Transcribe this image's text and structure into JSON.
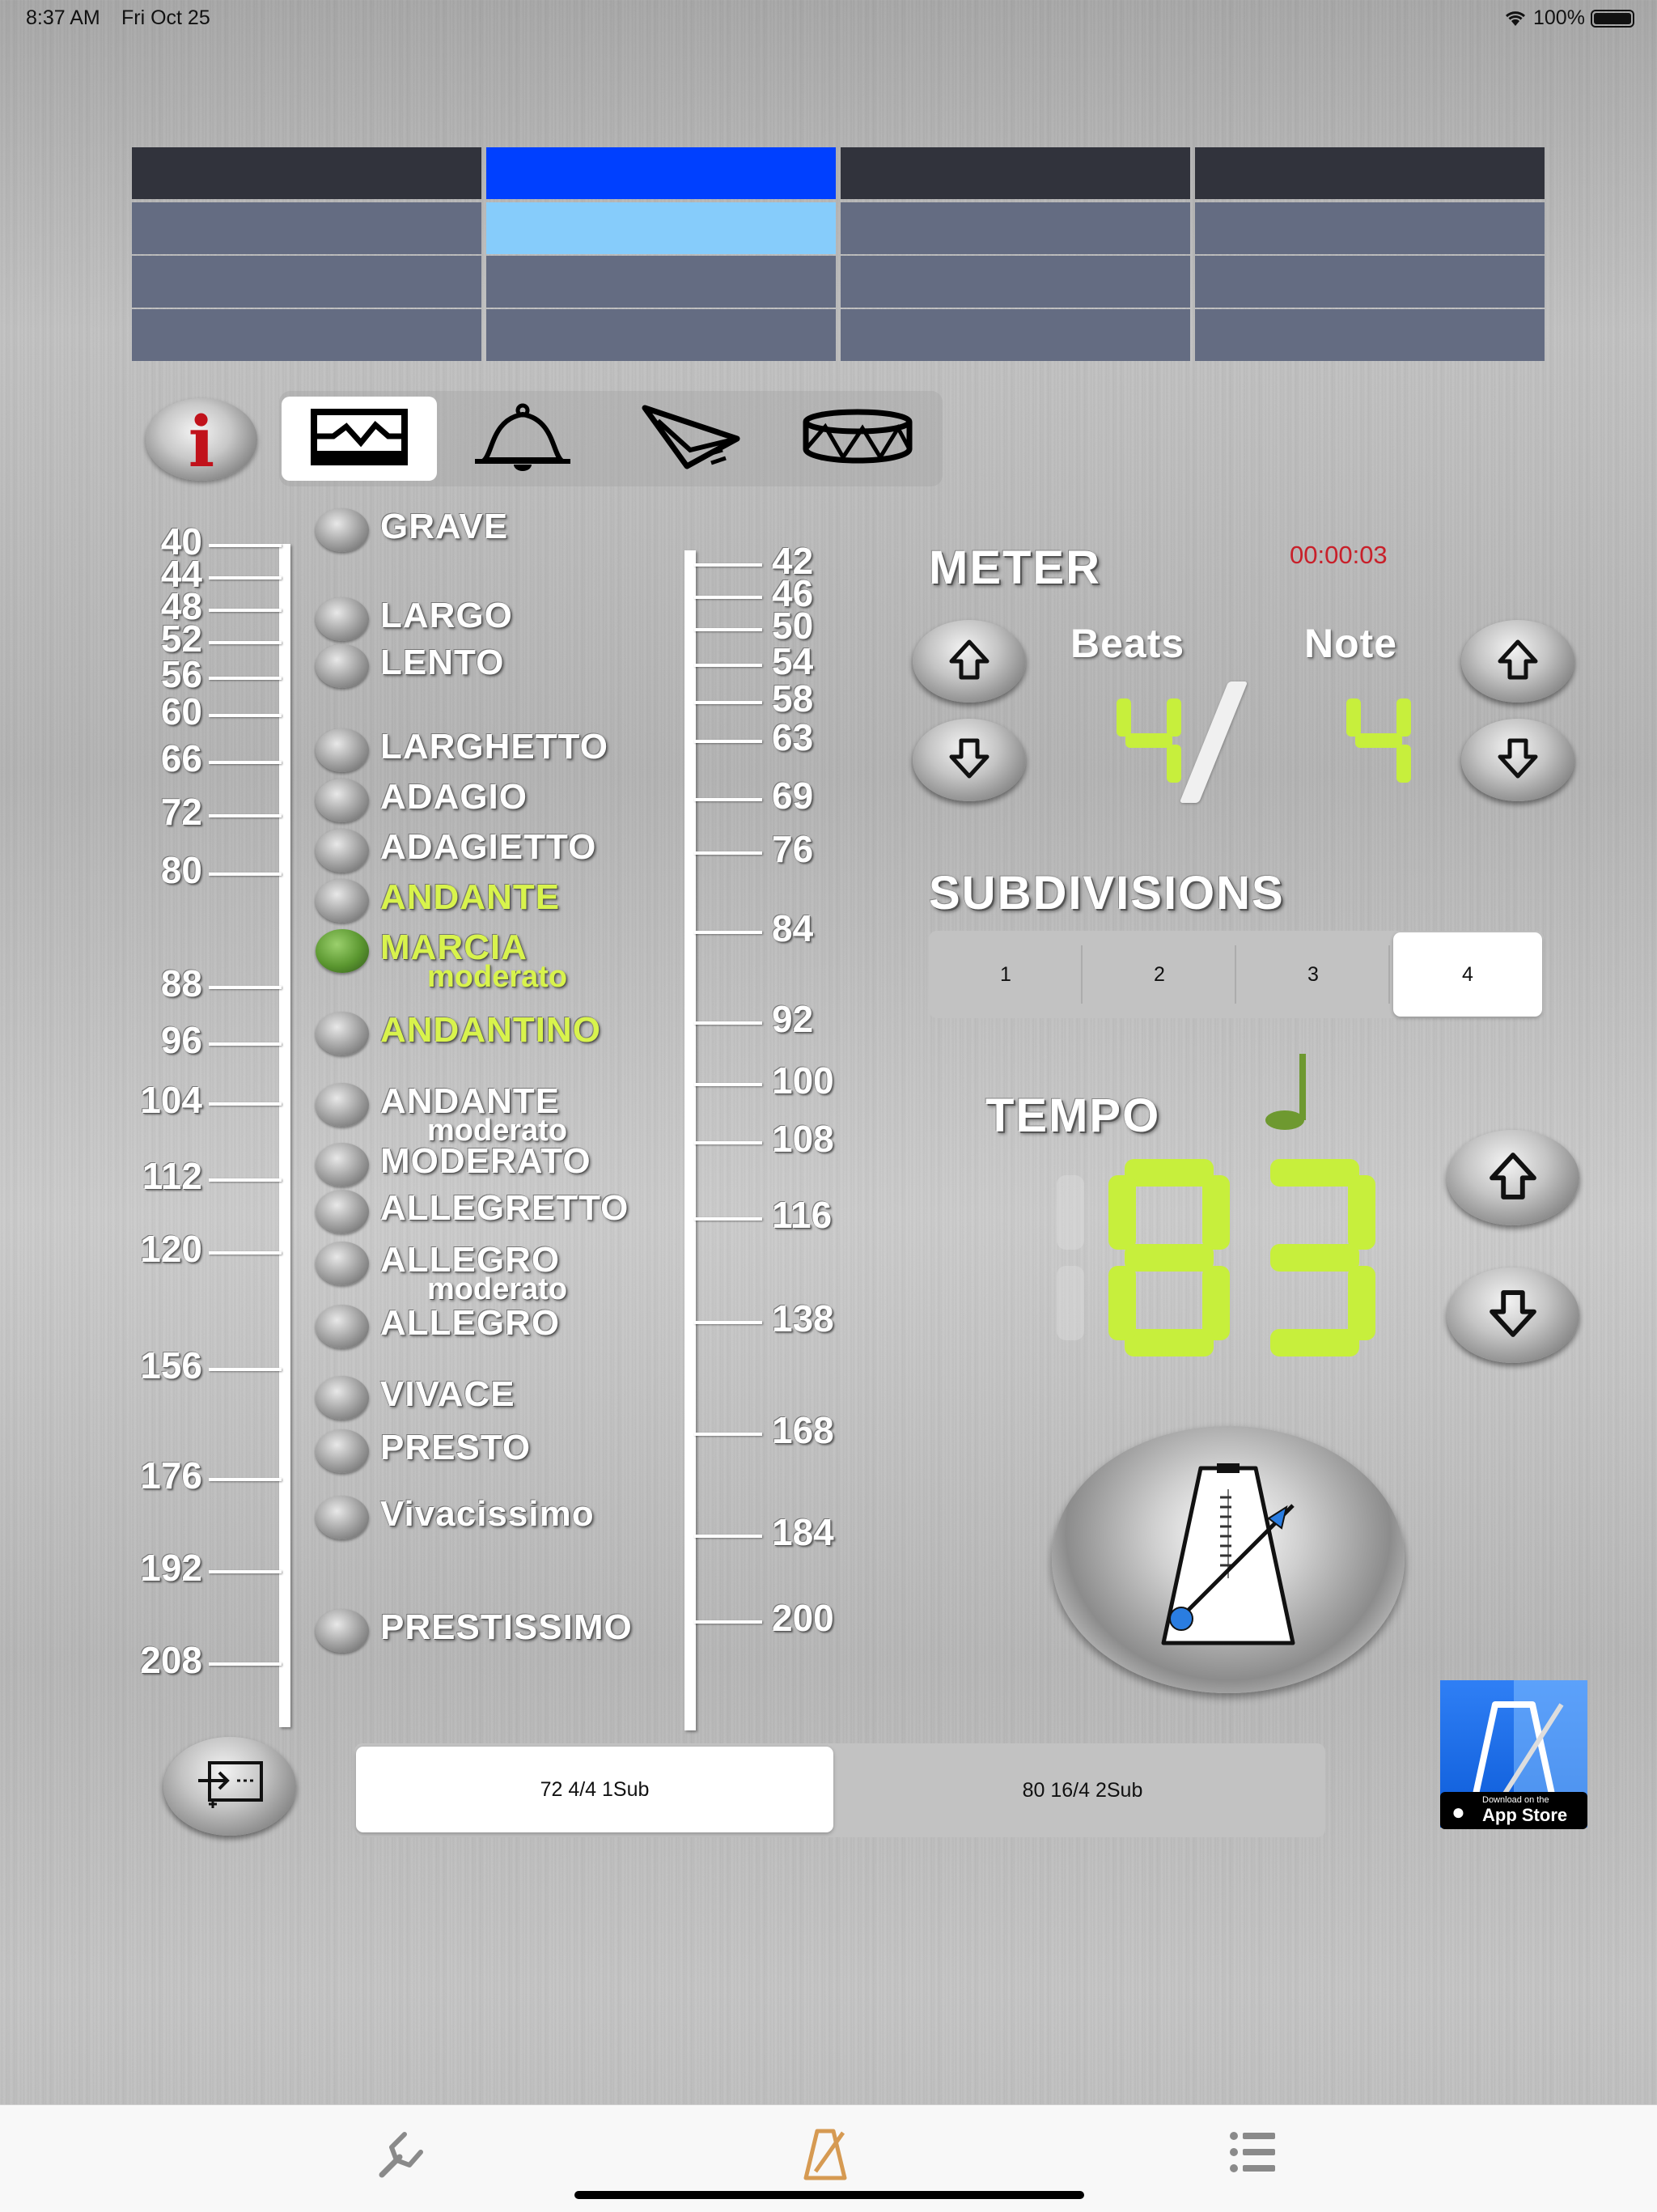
{
  "status_bar": {
    "time": "8:37 AM",
    "date": "Fri Oct 25",
    "battery": "100%"
  },
  "beat_grid": {
    "columns": 4,
    "rows": 4,
    "active_column": 2
  },
  "toolbar": {
    "info_label": "i",
    "icons": [
      "waveform-icon",
      "bell-icon",
      "paper-plane-icon",
      "drum-icon"
    ],
    "selected_index": 0
  },
  "left_scale": [
    "40",
    "44",
    "48",
    "52",
    "56",
    "60",
    "66",
    "72",
    "80",
    "88",
    "96",
    "104",
    "112",
    "120",
    "156",
    "176",
    "192",
    "208"
  ],
  "right_scale": [
    "42",
    "46",
    "50",
    "54",
    "58",
    "63",
    "69",
    "76",
    "84",
    "92",
    "100",
    "108",
    "116",
    "138",
    "168",
    "184",
    "200"
  ],
  "tempo_markings": [
    {
      "name": "GRAVE",
      "sub": "",
      "highlight": false,
      "active": false
    },
    {
      "name": "LARGO",
      "sub": "",
      "highlight": false,
      "active": false
    },
    {
      "name": "LENTO",
      "sub": "",
      "highlight": false,
      "active": false
    },
    {
      "name": "LARGHETTO",
      "sub": "",
      "highlight": false,
      "active": false
    },
    {
      "name": "ADAGIO",
      "sub": "",
      "highlight": false,
      "active": false
    },
    {
      "name": "ADAGIETTO",
      "sub": "",
      "highlight": false,
      "active": false
    },
    {
      "name": "ANDANTE",
      "sub": "",
      "highlight": true,
      "active": false
    },
    {
      "name": "MARCIA",
      "sub": "moderato",
      "highlight": true,
      "active": true
    },
    {
      "name": "ANDANTINO",
      "sub": "",
      "highlight": true,
      "active": false
    },
    {
      "name": "ANDANTE",
      "sub": "moderato",
      "highlight": false,
      "active": false
    },
    {
      "name": "MODERATO",
      "sub": "",
      "highlight": false,
      "active": false
    },
    {
      "name": "ALLEGRETTO",
      "sub": "",
      "highlight": false,
      "active": false
    },
    {
      "name": "ALLEGRO",
      "sub": "moderato",
      "highlight": false,
      "active": false
    },
    {
      "name": "ALLEGRO",
      "sub": "",
      "highlight": false,
      "active": false
    },
    {
      "name": "VIVACE",
      "sub": "",
      "highlight": false,
      "active": false
    },
    {
      "name": "PRESTO",
      "sub": "",
      "highlight": false,
      "active": false
    },
    {
      "name": "Vivacissimo",
      "sub": "",
      "highlight": false,
      "active": false
    },
    {
      "name": "PRESTISSIMO",
      "sub": "",
      "highlight": false,
      "active": false
    }
  ],
  "meter": {
    "label": "METER",
    "timer": "00:00:03",
    "beats_label": "Beats",
    "note_label": "Note",
    "beats": "4",
    "separator": "/",
    "note": "4"
  },
  "subdivisions": {
    "label": "SUBDIVISIONS",
    "options": [
      "1",
      "2",
      "3",
      "4"
    ],
    "selected_index": 3
  },
  "tempo": {
    "label": "TEMPO",
    "value": 83
  },
  "presets": {
    "options": [
      "72 4/4 1Sub",
      "80 16/4 2Sub"
    ],
    "selected_index": 0
  },
  "app_store_badge": {
    "small": "Download on the",
    "large": "App Store"
  },
  "tab_bar": {
    "tabs": [
      "tuner-tab-icon",
      "metronome-tab-icon",
      "list-tab-icon"
    ],
    "selected_index": 1
  },
  "colors": {
    "accent_green": "#c7ef3c",
    "highlight_text": "#d8f34c",
    "grid_active": "#0040ff",
    "grid_active_light": "#86ccfb",
    "timer_red": "#c8202a",
    "tab_active": "#d69a52"
  }
}
